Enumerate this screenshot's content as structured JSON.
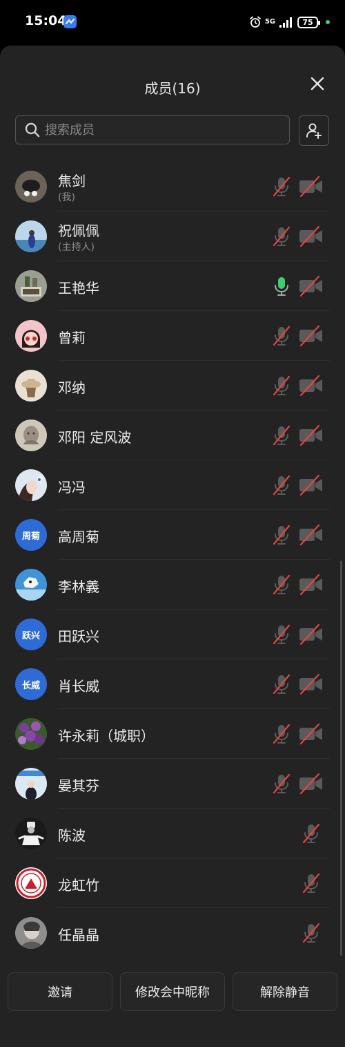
{
  "status_bar": {
    "time": "15:04",
    "network": "5G",
    "battery": "75"
  },
  "panel": {
    "title": "成员(16)",
    "search_placeholder": "搜索成员"
  },
  "members": [
    {
      "name": "焦剑",
      "role": "(我)",
      "mic": "muted",
      "camera": "off"
    },
    {
      "name": "祝佩佩",
      "role": "(主持人)",
      "mic": "muted",
      "camera": "off"
    },
    {
      "name": "王艳华",
      "role": "",
      "mic": "on",
      "camera": "off"
    },
    {
      "name": "曾莉",
      "role": "",
      "mic": "muted",
      "camera": "off"
    },
    {
      "name": "邓纳",
      "role": "",
      "mic": "muted",
      "camera": "off"
    },
    {
      "name": "邓阳 定风波",
      "role": "",
      "mic": "muted",
      "camera": "off"
    },
    {
      "name": "冯冯",
      "role": "",
      "mic": "muted",
      "camera": "off"
    },
    {
      "name": "高周菊",
      "avatar_text": "周菊",
      "role": "",
      "mic": "muted",
      "camera": "off"
    },
    {
      "name": "李林義",
      "role": "",
      "mic": "muted",
      "camera": "off"
    },
    {
      "name": "田跃兴",
      "avatar_text": "跃兴",
      "role": "",
      "mic": "muted",
      "camera": "off"
    },
    {
      "name": "肖长威",
      "avatar_text": "长威",
      "role": "",
      "mic": "muted",
      "camera": "off"
    },
    {
      "name": "许永莉（城职）",
      "role": "",
      "mic": "muted",
      "camera": "off"
    },
    {
      "name": "晏其芬",
      "role": "",
      "mic": "muted",
      "camera": "off"
    },
    {
      "name": "陈波",
      "role": "",
      "mic": "muted",
      "camera": "none"
    },
    {
      "name": "龙虹竹",
      "role": "",
      "mic": "muted",
      "camera": "none"
    },
    {
      "name": "任晶晶",
      "role": "",
      "mic": "muted",
      "camera": "none"
    }
  ],
  "actions": {
    "invite": "邀请",
    "rename": "修改会中昵称",
    "unmute": "解除静音"
  },
  "colors": {
    "panel_bg": "#232323",
    "mic_active": "#3bd16f",
    "mute_slash": "#e2463d",
    "initials_avatar": "#2f6bd6"
  }
}
